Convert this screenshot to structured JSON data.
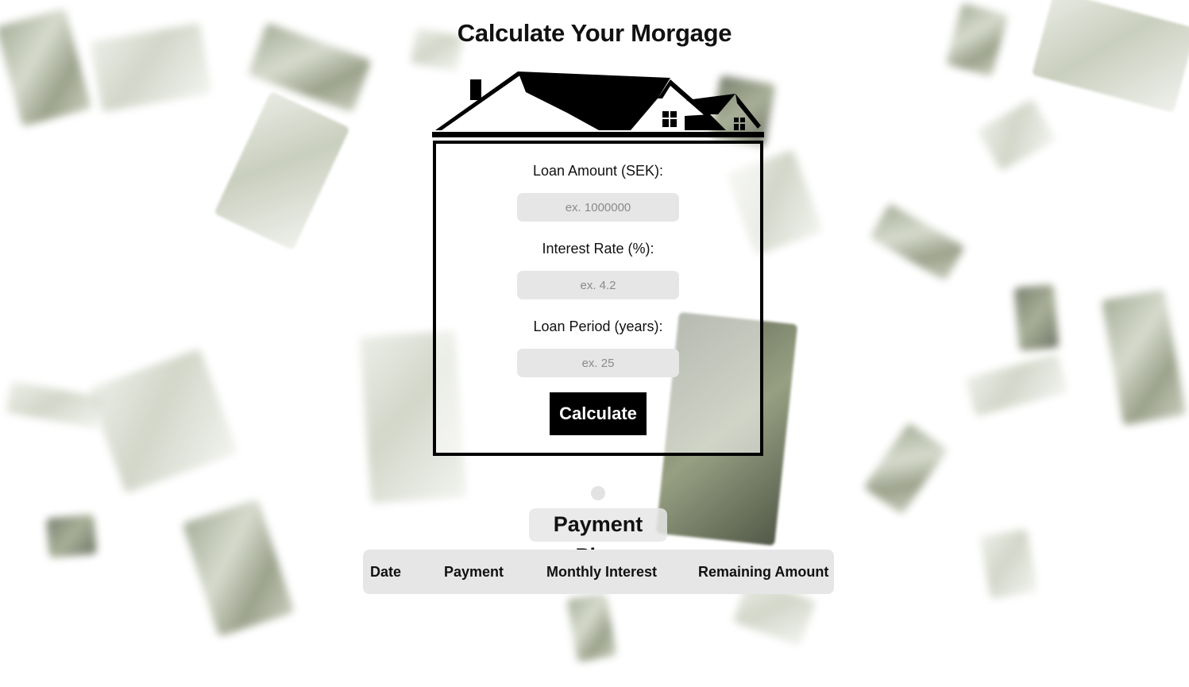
{
  "page": {
    "title": "Calculate Your Morgage"
  },
  "form": {
    "loan_amount": {
      "label": "Loan Amount (SEK):",
      "placeholder": "ex. 1000000",
      "value": ""
    },
    "interest_rate": {
      "label": "Interest Rate (%):",
      "placeholder": "ex. 4.2",
      "value": ""
    },
    "loan_period": {
      "label": "Loan Period (years):",
      "placeholder": "ex. 25",
      "value": ""
    },
    "submit_label": "Calculate"
  },
  "payment_plan": {
    "title": "Payment Plan",
    "columns": [
      "Date",
      "Payment",
      "Monthly Interest",
      "Remaining Amount"
    ],
    "rows": []
  },
  "icons": {
    "roof": "house-roof-icon"
  },
  "colors": {
    "accent": "#000000",
    "input_bg": "#e6e6e6",
    "table_bg": "#e6e6e6",
    "background": "#ffffff"
  }
}
